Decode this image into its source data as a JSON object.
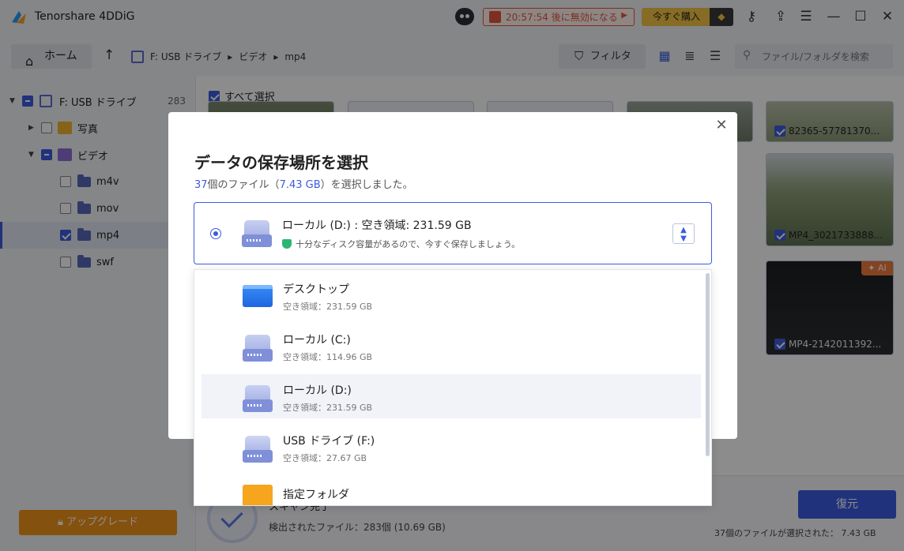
{
  "app": {
    "title": "Tenorshare 4DDiG"
  },
  "promo": {
    "timer_text": "20:57:54 後に無効になる",
    "buy_label": "今すぐ購入"
  },
  "toolbar": {
    "home_label": "ホーム",
    "breadcrumb": [
      "F: USB ドライブ",
      "ビデオ",
      "mp4"
    ],
    "filter_label": "フィルタ",
    "search_placeholder": "ファイル/フォルダを検索"
  },
  "sidebar": {
    "root": {
      "label": "F: USB ドライブ",
      "count": "283"
    },
    "items": [
      {
        "label": "写真"
      },
      {
        "label": "ビデオ"
      },
      {
        "label": "m4v"
      },
      {
        "label": "mov"
      },
      {
        "label": "mp4"
      },
      {
        "label": "swf"
      }
    ],
    "upgrade_label": "アップグレード"
  },
  "content": {
    "select_all": "すべて選択",
    "thumbs": [
      {
        "label": "82365-57781370..."
      },
      {
        "label": "MP4_3021733888..."
      },
      {
        "label": "MP4-2142011392..."
      }
    ],
    "ai_badge": "AI"
  },
  "bottom": {
    "scan_status": "スキャン完了",
    "found": "検出されたファイル：283個 (10.69 GB)",
    "recover_label": "復元",
    "selected_info": "37個のファイルが選択された： 7.43 GB"
  },
  "dialog": {
    "title": "データの保存場所を選択",
    "sub_count": "37",
    "sub_mid": "個のファイル（",
    "sub_size": "7.43 GB",
    "sub_end": "）を選択しました。",
    "selected": {
      "name": "ローカル (D:) : 空き領域:  231.59 GB",
      "note": "十分なディスク容量があるので、今すぐ保存しましょう。"
    },
    "options": [
      {
        "name": "デスクトップ",
        "free": "空き領域：231.59 GB"
      },
      {
        "name": "ローカル (C:)",
        "free": "空き領域：114.96 GB"
      },
      {
        "name": "ローカル (D:)",
        "free": "空き領域：231.59 GB"
      },
      {
        "name": "USB ドライブ (F:)",
        "free": "空き領域：27.67 GB"
      },
      {
        "name": "指定フォルダ",
        "free": ""
      }
    ]
  },
  "colors": {
    "accent": "#3b5be0",
    "warning": "#e8563a",
    "upgrade": "#f2941d"
  }
}
